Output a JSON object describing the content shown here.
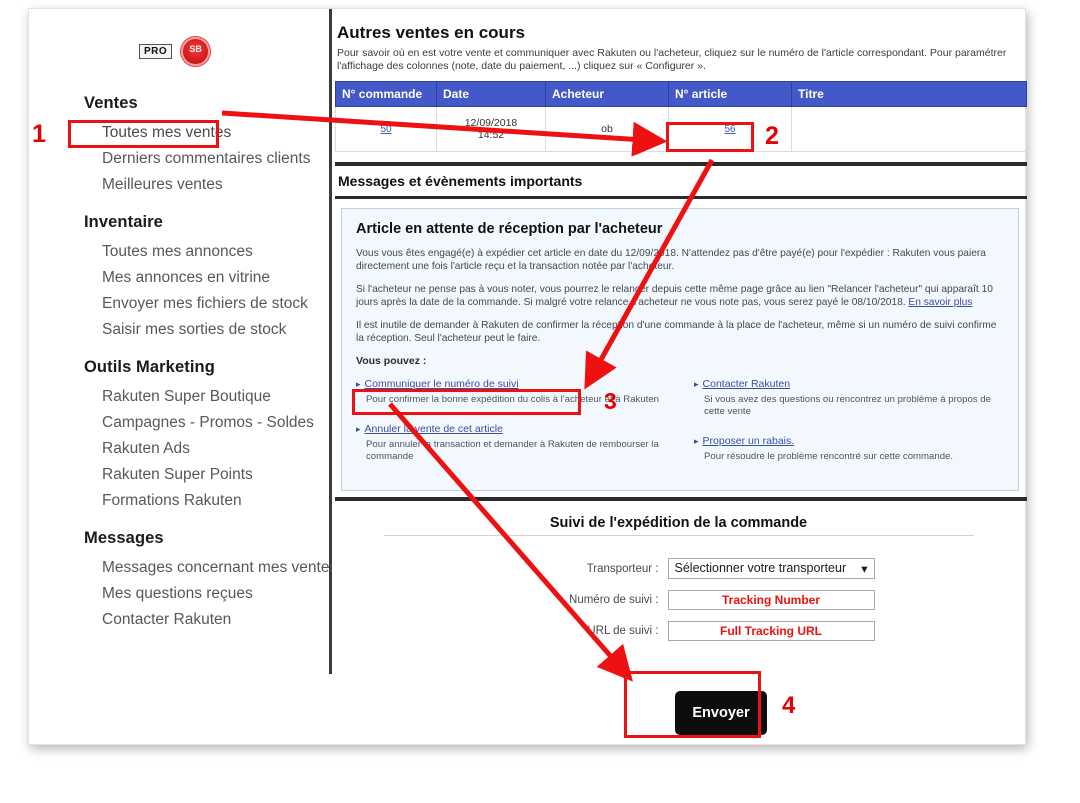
{
  "branding": {
    "pro_badge": "PRO",
    "medal_icon": "seller-medal-icon"
  },
  "sidebar": {
    "groups": [
      {
        "title": "Ventes",
        "items": [
          "Toutes mes ventes",
          "Derniers commentaires clients",
          "Meilleures ventes"
        ]
      },
      {
        "title": "Inventaire",
        "items": [
          "Toutes mes annonces",
          "Mes annonces en vitrine",
          "Envoyer mes fichiers de stock",
          "Saisir mes sorties de stock"
        ]
      },
      {
        "title": "Outils Marketing",
        "items": [
          "Rakuten Super Boutique",
          "Campagnes - Promos - Soldes",
          "Rakuten Ads",
          "Rakuten Super Points",
          "Formations Rakuten"
        ]
      },
      {
        "title": "Messages",
        "items": [
          "Messages concernant mes ventes",
          "Mes questions reçues",
          "Contacter Rakuten"
        ]
      }
    ]
  },
  "sales": {
    "title": "Autres ventes en cours",
    "description": "Pour savoir où en est votre vente et communiquer avec Rakuten ou l'acheteur, cliquez sur le numéro de l'article correspondant. Pour paramétrer l'affichage des colonnes (note, date du paiement, ...) cliquez sur « Configurer ».",
    "columns": [
      "N° commande",
      "Date",
      "Acheteur",
      "N° article",
      "Titre"
    ],
    "rows": [
      {
        "commande": "50",
        "date": "12/09/2018",
        "heure": "14:52",
        "acheteur": "ob",
        "article": "56",
        "titre": ""
      }
    ]
  },
  "messages_section": {
    "header": "Messages et évènements importants"
  },
  "infobox": {
    "heading": "Article en attente de réception par l'acheteur",
    "paragraphs": [
      "Vous vous êtes engagé(e) à expédier cet article en date du 12/09/2018. N'attendez pas d'être payé(e) pour l'expédier : Rakuten vous paiera directement une fois l'article reçu et la transaction notée par l'acheteur.",
      "Si l'acheteur ne pense pas à vous noter, vous pourrez le relancer depuis cette même page grâce au lien \"Relancer l'acheteur\" qui apparaît 10 jours après la date de la commande. Si malgré votre relance, l'acheteur ne vous note pas, vous serez payé le 08/10/2018. ",
      "Il est inutile de demander à Rakuten de confirmer la réception d'une commande à la place de l'acheteur, même si un numéro de suivi confirme la réception. Seul l'acheteur peut le faire."
    ],
    "learn_more": "En savoir plus",
    "vous_pouvez": "Vous pouvez :",
    "links_left": [
      {
        "label": "Communiquer le numéro de suivi",
        "desc": "Pour confirmer la bonne expédition du colis à l'acheteur et à Rakuten"
      },
      {
        "label": "Annuler la vente de cet article",
        "desc": "Pour annuler la transaction et demander à Rakuten de rembourser la commande"
      }
    ],
    "links_right": [
      {
        "label": "Contacter Rakuten",
        "desc": "Si vous avez des questions ou rencontrez un problème à propos de cette vente"
      },
      {
        "label": "Proposer un rabais.",
        "desc": "Pour résoudre le problème rencontré sur cette commande."
      }
    ]
  },
  "shipping": {
    "title": "Suivi de l'expédition de la commande",
    "fields": [
      {
        "label": "Transporteur :",
        "value": "Sélectionner votre transporteur",
        "type": "select"
      },
      {
        "label": "Numéro de suivi :",
        "value": "Tracking Number",
        "type": "text"
      },
      {
        "label": "URL de suivi :",
        "value": "Full Tracking URL",
        "type": "text"
      }
    ],
    "submit_label": "Envoyer"
  },
  "annotations": {
    "step1": "1",
    "step2": "2",
    "step3": "3",
    "step4": "4",
    "accent_color": "#ee1111"
  }
}
